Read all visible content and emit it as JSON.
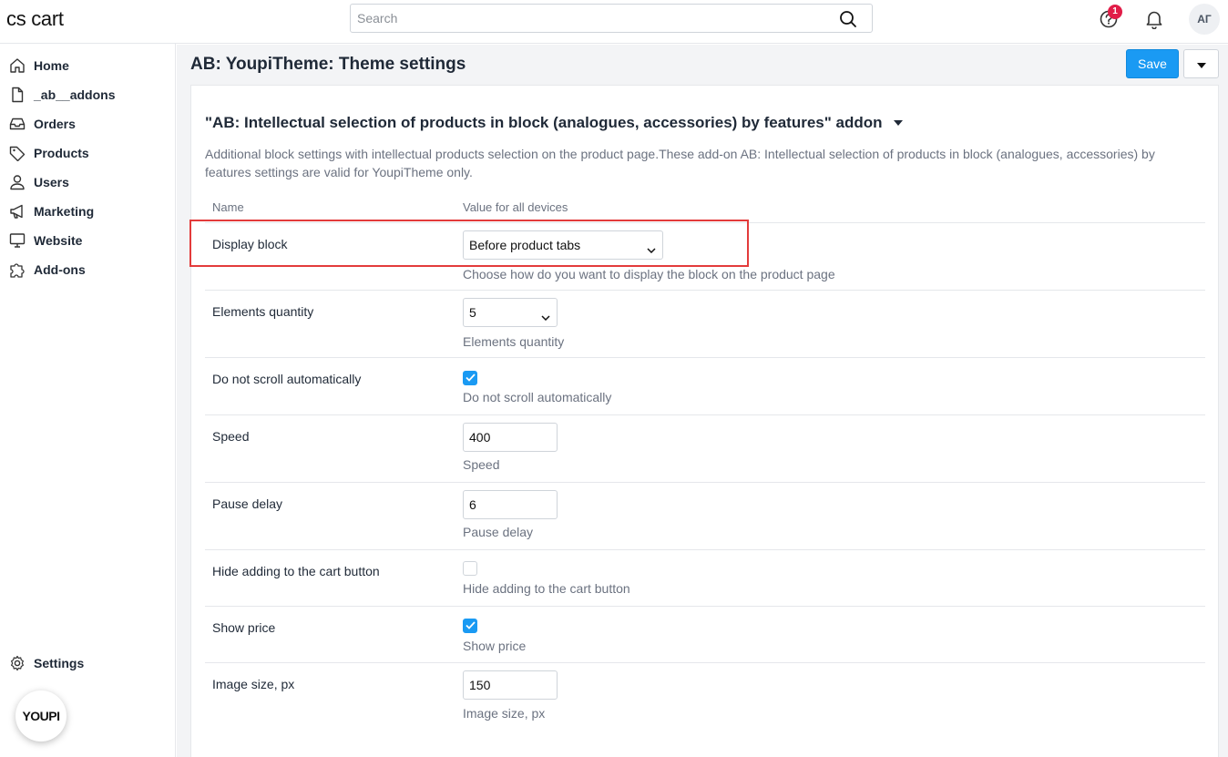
{
  "header": {
    "logo": "cs cart",
    "search_placeholder": "Search",
    "help_badge": "1",
    "avatar_initials": "АГ"
  },
  "sidebar": {
    "items": [
      {
        "label": "Home",
        "icon": "home-icon"
      },
      {
        "label": "_ab__addons",
        "icon": "file-icon"
      },
      {
        "label": "Orders",
        "icon": "inbox-icon"
      },
      {
        "label": "Products",
        "icon": "tag-icon"
      },
      {
        "label": "Users",
        "icon": "user-icon"
      },
      {
        "label": "Marketing",
        "icon": "megaphone-icon"
      },
      {
        "label": "Website",
        "icon": "monitor-icon"
      },
      {
        "label": "Add-ons",
        "icon": "puzzle-icon"
      }
    ],
    "settings_label": "Settings",
    "youpi_badge": "YOUPI"
  },
  "page": {
    "title": "AB: YoupiTheme: Theme settings",
    "save_label": "Save"
  },
  "section": {
    "title": "\"AB: Intellectual selection of products in block (analogues, accessories) by features\" addon",
    "description": "Additional block settings with intellectual products selection on the product page.These add-on AB: Intellectual selection of products in block (analogues, accessories) by features settings are valid for YoupiTheme only."
  },
  "table": {
    "col_name": "Name",
    "col_value": "Value for all devices",
    "rows": [
      {
        "name": "Display block",
        "type": "select",
        "value": "Before product tabs",
        "hint": "Choose how do you want to display the block on the product page"
      },
      {
        "name": "Elements quantity",
        "type": "select",
        "value": "5",
        "hint": "Elements quantity"
      },
      {
        "name": "Do not scroll automatically",
        "type": "checkbox",
        "checked": true,
        "hint": "Do not scroll automatically"
      },
      {
        "name": "Speed",
        "type": "input",
        "value": "400",
        "hint": "Speed"
      },
      {
        "name": "Pause delay",
        "type": "input",
        "value": "6",
        "hint": "Pause delay"
      },
      {
        "name": "Hide adding to the cart button",
        "type": "checkbox",
        "checked": false,
        "hint": "Hide adding to the cart button"
      },
      {
        "name": "Show price",
        "type": "checkbox",
        "checked": true,
        "hint": "Show price"
      },
      {
        "name": "Image size, px",
        "type": "input",
        "value": "150",
        "hint": "Image size, px"
      }
    ]
  },
  "colors": {
    "accent": "#1a9af3",
    "highlight": "#e33b3b",
    "badge": "#e11d48"
  }
}
